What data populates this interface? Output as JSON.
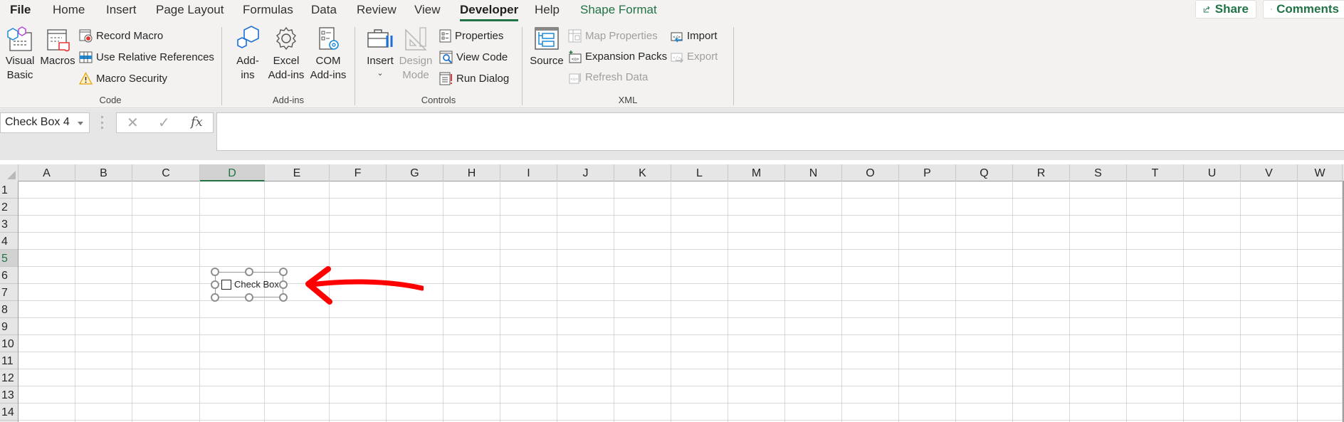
{
  "tabs": {
    "file": "File",
    "items": [
      "Home",
      "Insert",
      "Page Layout",
      "Formulas",
      "Data",
      "Review",
      "View",
      "Developer",
      "Help"
    ],
    "active": "Developer",
    "contextual": "Shape Format"
  },
  "top_buttons": {
    "share": "Share",
    "comments": "Comments"
  },
  "ribbon": {
    "groups": {
      "code": {
        "label": "Code",
        "visual_basic": [
          "Visual",
          "Basic"
        ],
        "macros": "Macros",
        "record_macro": "Record Macro",
        "use_relative_references": "Use Relative References",
        "macro_security": "Macro Security"
      },
      "addins": {
        "label": "Add-ins",
        "addins": [
          "Add-",
          "ins"
        ],
        "excel_addins": [
          "Excel",
          "Add-ins"
        ],
        "com_addins": [
          "COM",
          "Add-ins"
        ]
      },
      "controls": {
        "label": "Controls",
        "insert": "Insert",
        "design_mode": [
          "Design",
          "Mode"
        ],
        "properties": "Properties",
        "view_code": "View Code",
        "run_dialog": "Run Dialog"
      },
      "xml": {
        "label": "XML",
        "source": "Source",
        "map_properties": "Map Properties",
        "expansion_packs": "Expansion Packs",
        "refresh_data": "Refresh Data",
        "import": "Import",
        "export": "Export"
      }
    },
    "disabled": [
      "Design Mode",
      "Map Properties",
      "Refresh Data",
      "Export"
    ]
  },
  "formula_bar": {
    "name_box": "Check Box 4",
    "cancel_icon": "✕",
    "enter_icon": "✓",
    "fx_label": "fx",
    "value": ""
  },
  "sheet": {
    "columns": [
      "A",
      "B",
      "C",
      "D",
      "E",
      "F",
      "G",
      "H",
      "I",
      "J",
      "K",
      "L",
      "M",
      "N",
      "O",
      "P",
      "Q",
      "R",
      "S",
      "T",
      "U",
      "V",
      "W"
    ],
    "rows": [
      "1",
      "2",
      "3",
      "4",
      "5",
      "6",
      "7",
      "8",
      "9",
      "10",
      "11",
      "12",
      "13",
      "14"
    ],
    "selected_column": "D",
    "selected_row": "5"
  },
  "form_control": {
    "type": "checkbox",
    "label": "Check Box",
    "checked": false,
    "selected": true
  },
  "annotation": {
    "type": "arrow",
    "color": "#ff0000",
    "points_to": "Check Box"
  },
  "colors": {
    "accent": "#217346",
    "ribbon_bg": "#f3f2f1",
    "grid_line": "#d9d9d9"
  }
}
